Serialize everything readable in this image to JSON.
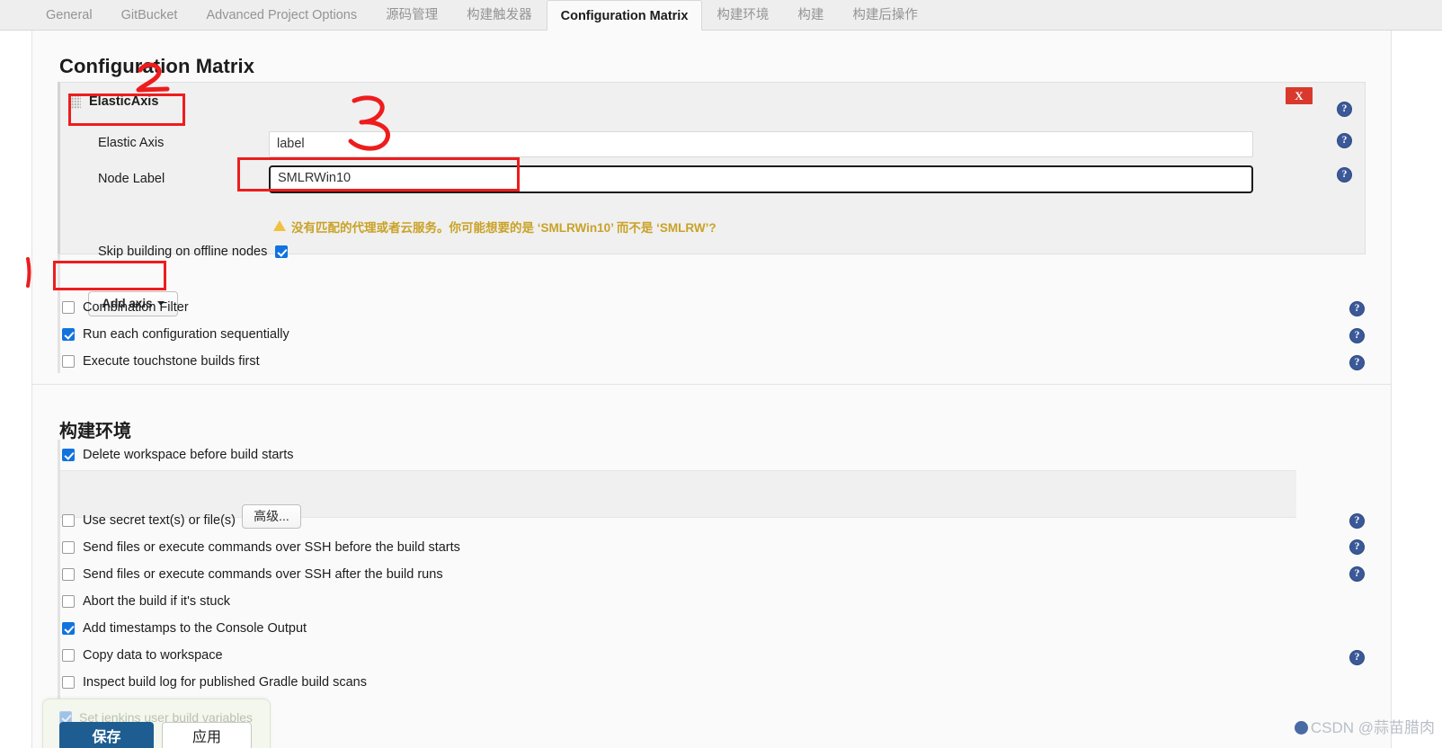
{
  "tabs": [
    {
      "label": "General",
      "active": false
    },
    {
      "label": "GitBucket",
      "active": false
    },
    {
      "label": "Advanced Project Options",
      "active": false
    },
    {
      "label": "源码管理",
      "active": false
    },
    {
      "label": "构建触发器",
      "active": false
    },
    {
      "label": "Configuration Matrix",
      "active": true
    },
    {
      "label": "构建环境",
      "active": false
    },
    {
      "label": "构建",
      "active": false
    },
    {
      "label": "构建后操作",
      "active": false
    }
  ],
  "page": {
    "title": "Configuration Matrix"
  },
  "axis_panel": {
    "title": "ElasticAxis",
    "delete_label": "X",
    "rows": [
      {
        "label": "Elastic Axis",
        "value": "label"
      },
      {
        "label": "Node Label",
        "value": "SMLRWin10"
      }
    ],
    "warning": "没有匹配的代理或者云服务。你可能想要的是 ‘SMLRWin10’ 而不是 ‘SMLRW’?",
    "skip_offline_label": "Skip building on offline nodes",
    "skip_offline_checked": true,
    "help_label": "?"
  },
  "matrix": {
    "add_axis_label": "Add axis",
    "options": [
      {
        "label": "Combination Filter",
        "checked": false,
        "help": true
      },
      {
        "label": "Run each configuration sequentially",
        "checked": true,
        "help": true
      },
      {
        "label": "Execute touchstone builds first",
        "checked": false,
        "help": true
      }
    ]
  },
  "build_env": {
    "title": "构建环境",
    "delete_workspace": {
      "label": "Delete workspace before build starts",
      "checked": true
    },
    "advanced_label": "高级...",
    "options": [
      {
        "label": "Use secret text(s) or file(s)",
        "checked": false,
        "help": true
      },
      {
        "label": "Send files or execute commands over SSH before the build starts",
        "checked": false,
        "help": true
      },
      {
        "label": "Send files or execute commands over SSH after the build runs",
        "checked": false,
        "help": true
      },
      {
        "label": "Abort the build if it's stuck",
        "checked": false,
        "help": false
      },
      {
        "label": "Add timestamps to the Console Output",
        "checked": true,
        "help": false
      },
      {
        "label": "Copy data to workspace",
        "checked": false,
        "help": true
      },
      {
        "label": "Inspect build log for published Gradle build scans",
        "checked": false,
        "help": false
      }
    ]
  },
  "savebar": {
    "hidden_option_label": "Set jenkins user build variables",
    "save_label": "保存",
    "apply_label": "应用"
  },
  "annotations": {
    "marks": [
      {
        "text": "1",
        "note": "points to Add axis button"
      },
      {
        "text": "2",
        "note": "points to ElasticAxis header"
      },
      {
        "text": "3",
        "note": "points to Node Label field"
      }
    ],
    "color": "#ee1c1c"
  },
  "watermark": {
    "text": "CSDN @蒜苗腊肉"
  },
  "colors": {
    "accent_blue": "#1273de",
    "danger_red": "#d9382c",
    "warning_gold": "#c9a227",
    "save_blue": "#1d5d92",
    "annotation_red": "#ee1c1c"
  }
}
